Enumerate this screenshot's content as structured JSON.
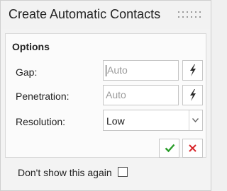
{
  "dialog": {
    "title": "Create Automatic Contacts"
  },
  "options": {
    "section_title": "Options",
    "gap": {
      "label": "Gap:",
      "placeholder": "Auto",
      "value": "",
      "auto_icon": "lightning-icon"
    },
    "penetration": {
      "label": "Penetration:",
      "placeholder": "Auto",
      "value": "",
      "auto_icon": "lightning-icon"
    },
    "resolution": {
      "label": "Resolution:",
      "selected": "Low"
    }
  },
  "actions": {
    "ok_icon": "checkmark-icon",
    "cancel_icon": "close-icon",
    "ok_color": "#2a9d2a",
    "cancel_color": "#d9262b"
  },
  "footer": {
    "dont_show_label": "Don't show this again",
    "dont_show_checked": false
  }
}
